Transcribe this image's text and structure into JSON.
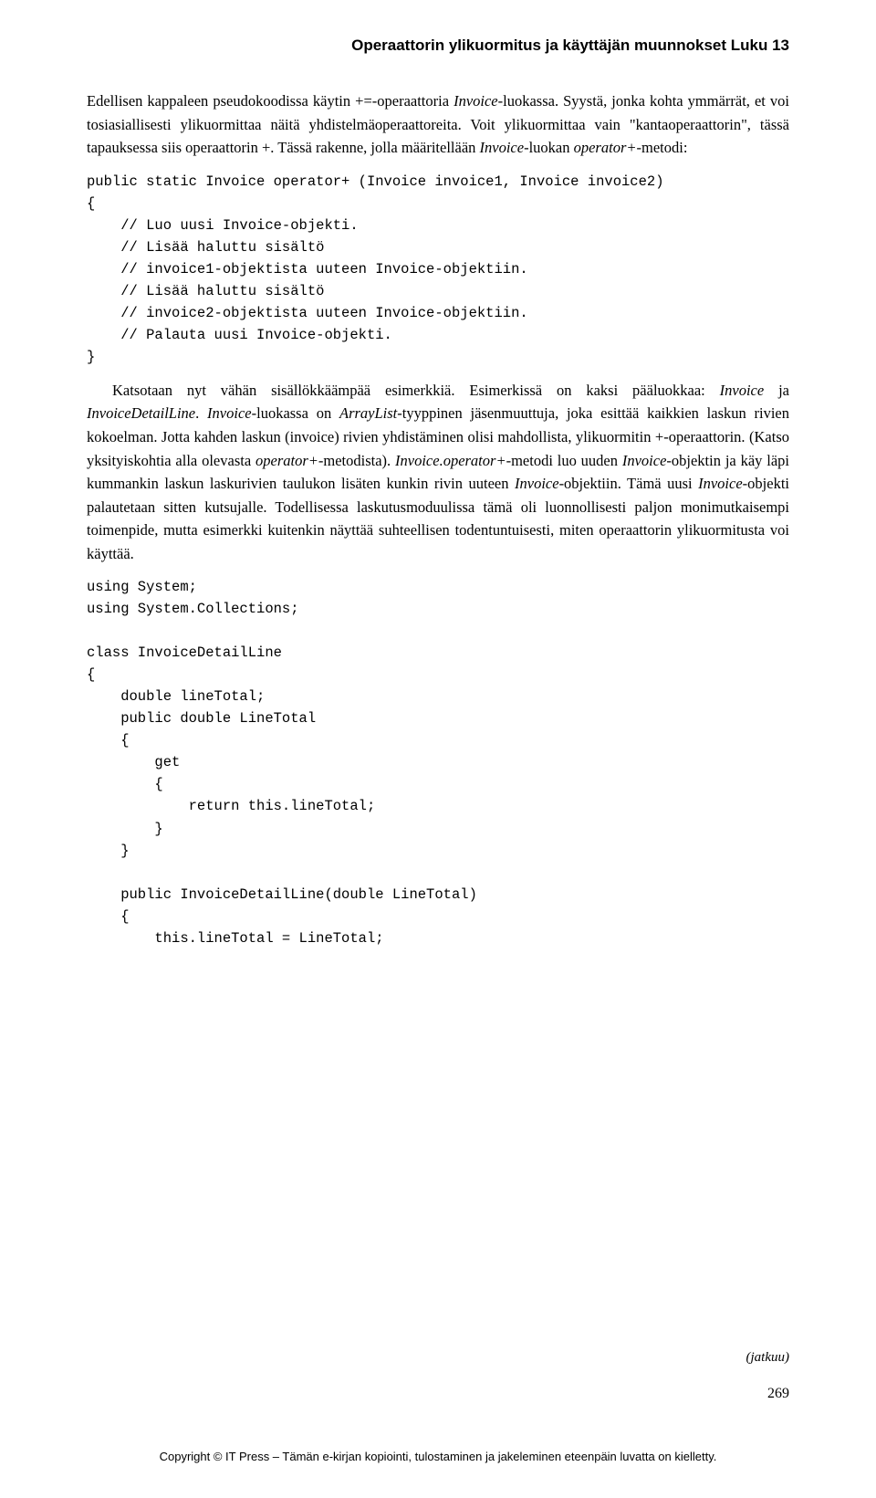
{
  "header": {
    "text": "Operaattorin ylikuormitus ja käyttäjän muunnokset  Luku 13"
  },
  "para1_prefix": "Edellisen kappaleen pseudokoodissa käytin +=-operaattoria ",
  "para1_em1": "Invoice",
  "para1_mid1": "-luokassa. Syystä, jonka kohta ymmärrät, et voi tosiasiallisesti ylikuormittaa näitä yhdistelmäoperaattoreita. Voit ylikuormittaa vain \"kantaoperaattorin\", tässä tapauksessa  siis operaattorin +. Tässä rakenne, jolla määritellään ",
  "para1_em2": "Invoice",
  "para1_mid2": "-luokan ",
  "para1_em3": "operator+",
  "para1_suffix": "-metodi:",
  "code1": "public static Invoice operator+ (Invoice invoice1, Invoice invoice2)\n{\n    // Luo uusi Invoice-objekti.\n    // Lisää haluttu sisältö\n    // invoice1-objektista uuteen Invoice-objektiin.\n    // Lisää haluttu sisältö\n    // invoice2-objektista uuteen Invoice-objektiin.\n    // Palauta uusi Invoice-objekti.\n}",
  "para2_prefix": "Katsotaan nyt vähän sisällökkäämpää esimerkkiä. Esimerkissä on kaksi pääluokkaa: ",
  "para2_em1": "Invoice",
  "para2_mid1": " ja ",
  "para2_em2": "InvoiceDetailLine",
  "para2_mid2": ". ",
  "para2_em3": "Invoice",
  "para2_mid3": "-luokassa on ",
  "para2_em4": "ArrayList",
  "para2_mid4": "-tyyppinen jäsenmuuttuja, joka esittää kaikkien laskun rivien kokoelman. Jotta kahden laskun (invoice) rivien yhdistäminen olisi mahdollista, ylikuormitin +-operaattorin. (Katso yksityiskohtia alla olevasta ",
  "para2_em5": "operator+",
  "para2_mid5": "-metodista). ",
  "para2_em6": "Invoice.operator+",
  "para2_mid6": "-metodi luo uuden ",
  "para2_em7": "Invoice",
  "para2_mid7": "-objektin ja käy läpi kummankin laskun laskurivien taulukon lisäten kunkin rivin uuteen ",
  "para2_em8": "Invoice",
  "para2_mid8": "-objektiin. Tämä uusi ",
  "para2_em9": "Invoice",
  "para2_suffix": "-objekti palautetaan sitten kutsujalle. Todellisessa laskutusmoduulissa tämä oli luonnollisesti paljon monimutkaisempi toimenpide, mutta esimerkki kuitenkin näyttää suhteellisen todentuntuisesti, miten operaattorin ylikuormitusta voi käyttää.",
  "code2": "using System;\nusing System.Collections;\n\nclass InvoiceDetailLine\n{\n    double lineTotal;\n    public double LineTotal\n    {\n        get\n        {\n            return this.lineTotal;\n        }\n    }\n\n    public InvoiceDetailLine(double LineTotal)\n    {\n        this.lineTotal = LineTotal;",
  "jatkuu": "(jatkuu)",
  "page_number": "269",
  "footer": "Copyright © IT Press – Tämän e-kirjan kopiointi, tulostaminen ja jakeleminen eteenpäin luvatta on kielletty."
}
